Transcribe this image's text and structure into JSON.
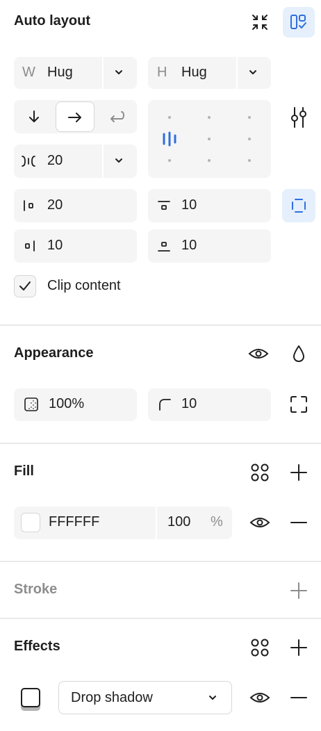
{
  "auto_layout": {
    "title": "Auto layout",
    "width": {
      "prefix": "W",
      "value": "Hug"
    },
    "height": {
      "prefix": "H",
      "value": "Hug"
    },
    "gap": "20",
    "padding_left": "20",
    "padding_top": "10",
    "padding_right": "10",
    "padding_bottom": "10",
    "clip_content_label": "Clip content",
    "clip_content_checked": true,
    "accent": "#2f6ee0"
  },
  "appearance": {
    "title": "Appearance",
    "opacity": "100%",
    "corner_radius": "10"
  },
  "fill": {
    "title": "Fill",
    "hex": "FFFFFF",
    "opacity": "100",
    "unit": "%",
    "swatch": "#ffffff"
  },
  "stroke": {
    "title": "Stroke"
  },
  "effects": {
    "title": "Effects",
    "effect_type": "Drop shadow"
  }
}
